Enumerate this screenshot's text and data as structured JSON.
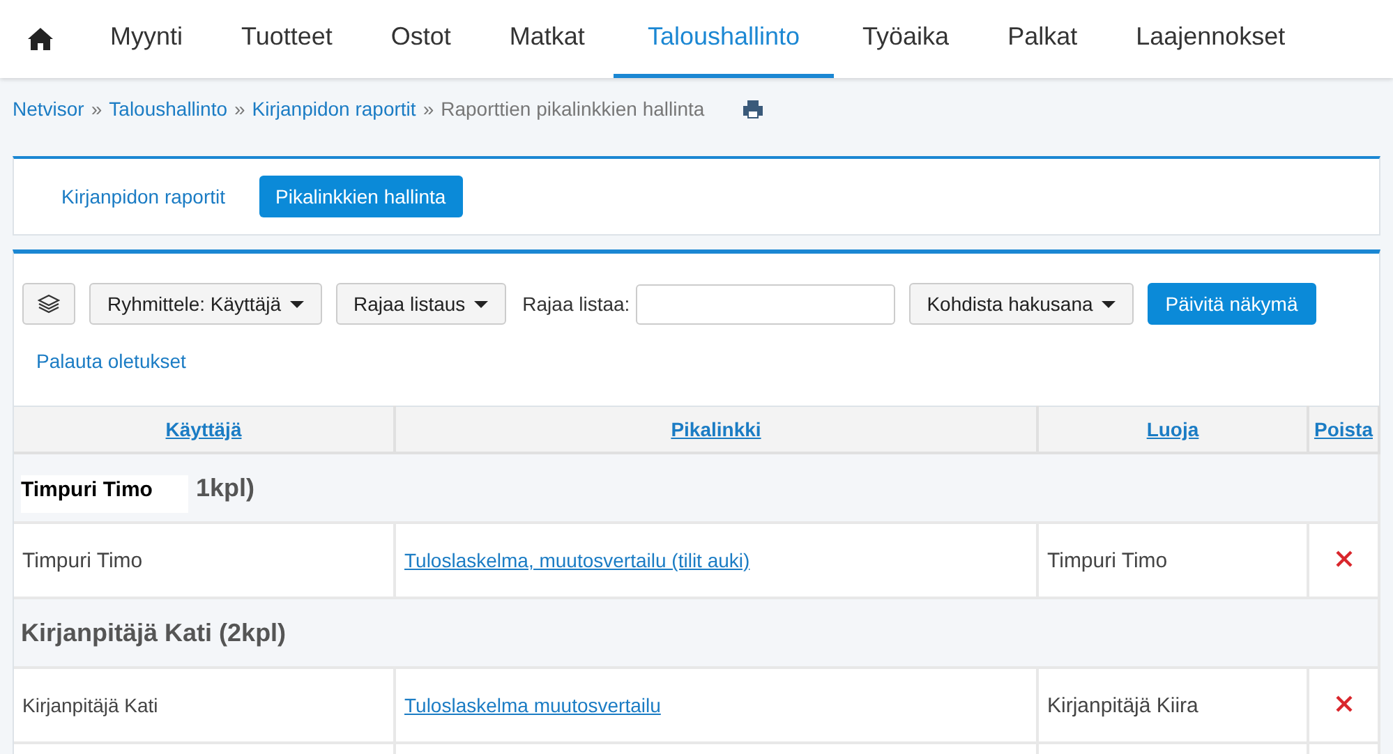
{
  "nav": [
    {
      "label": "Myynti",
      "selected": false
    },
    {
      "label": "Tuotteet",
      "selected": false
    },
    {
      "label": "Ostot",
      "selected": false
    },
    {
      "label": "Matkat",
      "selected": false
    },
    {
      "label": "Taloushallinto",
      "selected": true
    },
    {
      "label": "Työaika",
      "selected": false
    },
    {
      "label": "Palkat",
      "selected": false
    },
    {
      "label": "Laajennokset",
      "selected": false
    }
  ],
  "breadcrumb": [
    {
      "label": "Netvisor",
      "kind": "link"
    },
    {
      "label": "»",
      "kind": "sep"
    },
    {
      "label": "Taloushallinto",
      "kind": "link"
    },
    {
      "label": "»",
      "kind": "sep"
    },
    {
      "label": "Kirjanpidon raportit",
      "kind": "link"
    },
    {
      "label": "»",
      "kind": "sep"
    },
    {
      "label": "Raporttien pikalinkkien hallinta",
      "kind": "current"
    }
  ],
  "subtabs": [
    {
      "label": "Kirjanpidon raportit",
      "selected": false
    },
    {
      "label": "Pikalinkkien hallinta",
      "selected": true
    }
  ],
  "toolbar": {
    "group_by": "Ryhmittele: Käyttäjä",
    "filter": "Rajaa listaus",
    "search_label": "Rajaa listaa:",
    "target": "Kohdista hakusana",
    "refresh": "Päivitä näkymä",
    "reset": "Palauta oletukset"
  },
  "table": {
    "columns": [
      "Käyttäjä",
      "Pikalinkki",
      "Luoja",
      "Poista"
    ],
    "groups": [
      {
        "title": {
          "text": "Timpuri Timo",
          "overlay": true
        },
        "count": "1kpl)",
        "rows": [
          {
            "user": {
              "text": "Timpuri Timo",
              "overlay": true
            },
            "link": "Tuloslaskelma, muutosvertailu (tilit auki)",
            "creator": {
              "text": "Timpuri Timo",
              "overlay": true
            }
          }
        ]
      },
      {
        "title": {
          "text": "Kirjanpitäjä Kati",
          "overlay": false
        },
        "count": "(2kpl)",
        "rows": [
          {
            "user": {
              "text": "Kirjanpitäjä Kati",
              "overlay": false
            },
            "link": "Tuloslaskelma muutosvertailu",
            "creator": {
              "text": "Kirjanpitäjä Kiira",
              "overlay": true
            }
          }
        ]
      }
    ]
  }
}
